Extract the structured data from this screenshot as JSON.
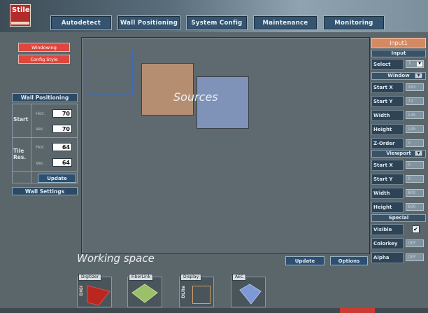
{
  "app": {
    "logo_text": "Stile"
  },
  "nav": {
    "autodetect": "Autodetect",
    "wall_positioning": "Wall Positioning",
    "system_config": "System Config",
    "maintenance": "Maintenance",
    "monitoring": "Monitoring"
  },
  "left": {
    "windowing": "Windowing",
    "config_style": "Config Style",
    "wall_positioning_header": "Wall Positioning",
    "start_label": "Start",
    "tile_res_label_1": "Tile",
    "tile_res_label_2": "Res.",
    "hor": "Hor.",
    "ver": "Ver.",
    "start_hor": "70",
    "start_ver": "70",
    "tile_hor": "64",
    "tile_ver": "64",
    "update": "Update",
    "wall_settings": "Wall Settings"
  },
  "workspace": {
    "sources_label": "Sources",
    "working_space_label": "Working space",
    "update": "Update",
    "options": "Options"
  },
  "right": {
    "tab": "Input1",
    "input_header": "Input",
    "select_label": "Select",
    "select_value": "1",
    "window_header": "Window",
    "start_x": "Start X",
    "start_x_val": "163",
    "start_y": "Start Y",
    "start_y_val": "72",
    "width": "Width",
    "width_val": "145",
    "height": "Height",
    "height_val": "145",
    "z_order": "Z-Order",
    "z_order_val": "0",
    "viewport_header": "Viewport",
    "vp_start_x": "Start X",
    "vp_start_x_val": "0",
    "vp_start_y": "Start Y",
    "vp_start_y_val": "0",
    "vp_width": "Width",
    "vp_width_val": "800",
    "vp_height": "Height",
    "vp_height_val": "600",
    "special_header": "Special",
    "visible": "Visible",
    "visible_val": "✔",
    "colorkey": "Colorkey",
    "colorkey_val": "OFF",
    "alpha": "Alpha",
    "alpha_val": "OFF"
  },
  "modules": {
    "digitizer": "Digitizer",
    "digitizer_side": "DIGI",
    "fiberlink": "FiberLink",
    "display": "Display",
    "display_side": "DLite",
    "aec": "AEC"
  },
  "colors": {
    "source_tan": "#b58e72",
    "source_blue": "#7f92b8",
    "source_outline": "#3f69b6",
    "accent_red": "#e0463c",
    "tab_orange": "#d38a63"
  }
}
